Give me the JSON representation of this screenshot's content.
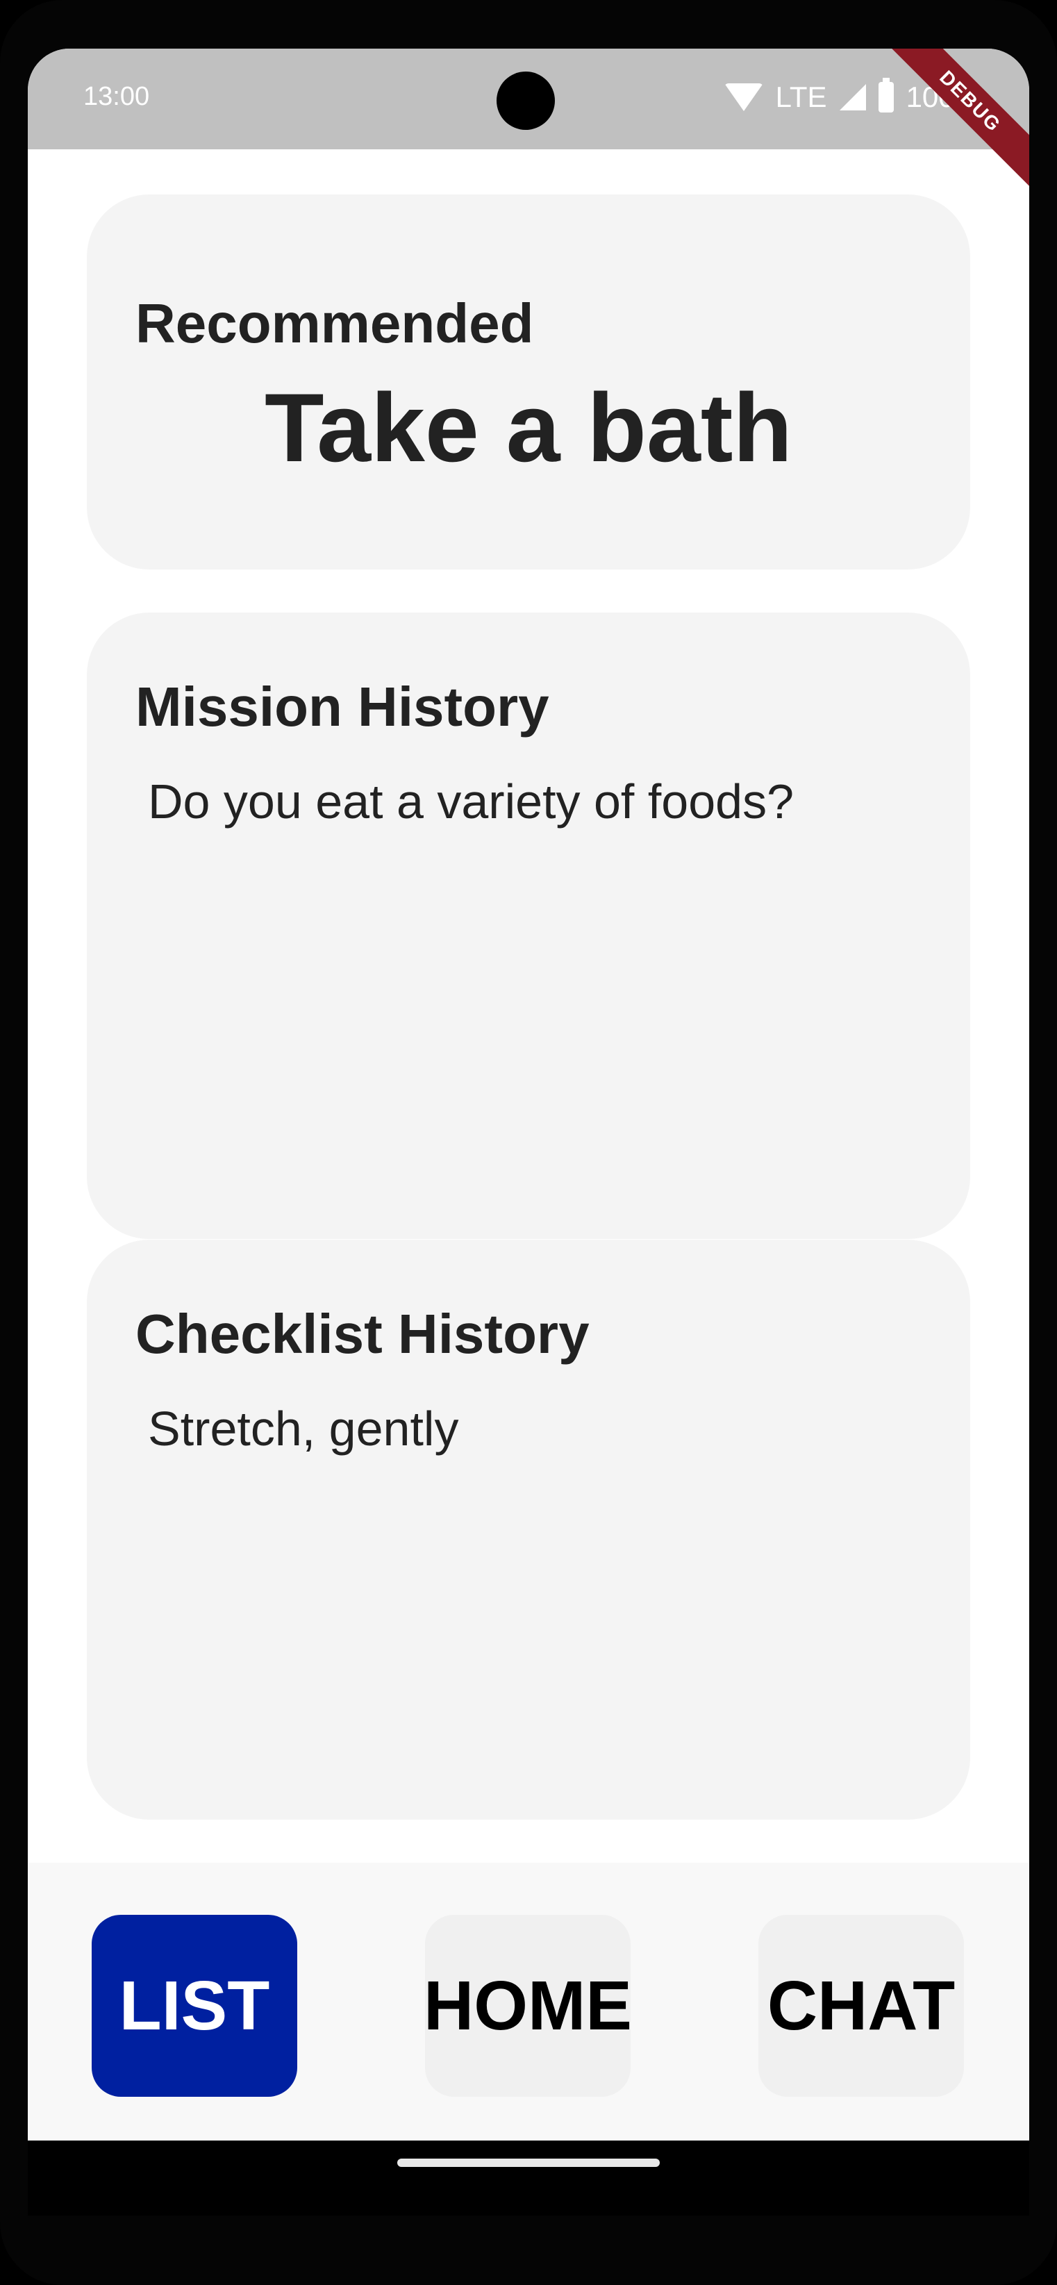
{
  "status_bar": {
    "time": "13:00",
    "network": "LTE",
    "battery": "100%",
    "debug_label": "DEBUG"
  },
  "recommended": {
    "heading": "Recommended",
    "title": "Take a bath"
  },
  "mission_history": {
    "heading": "Mission History",
    "item": "Do you eat a variety of foods?"
  },
  "checklist_history": {
    "heading": "Checklist History",
    "item": "Stretch, gently"
  },
  "bottom_nav": {
    "list_label": "LIST",
    "home_label": "HOME",
    "chat_label": "CHAT",
    "active": "LIST",
    "active_color": "#0020a0"
  }
}
